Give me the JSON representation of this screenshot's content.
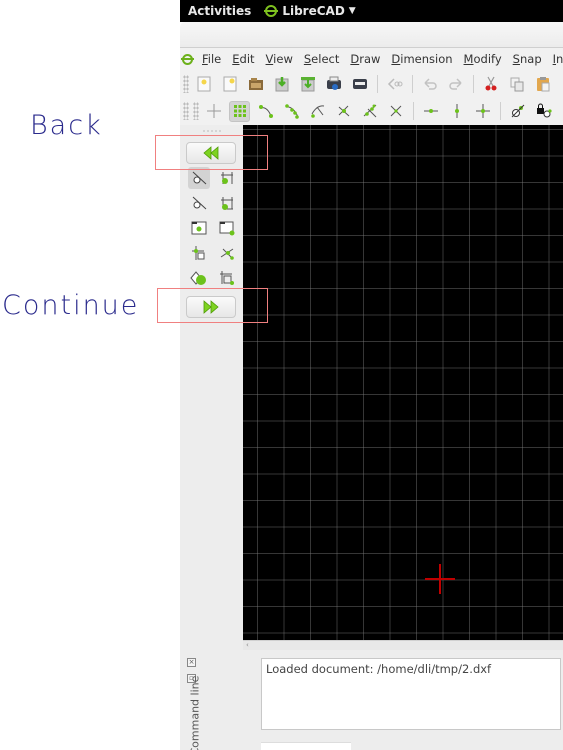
{
  "overlay": {
    "back_label": "Back",
    "continue_label": "Continue",
    "highlight_color": "#f08080",
    "label_color": "#2a2a8c"
  },
  "system_bar": {
    "activities": "Activities",
    "app_name": "LibreCAD",
    "app_menu_icon": "chevron-down-icon"
  },
  "menubar": {
    "items": [
      {
        "label": "File",
        "mnemonic": "F"
      },
      {
        "label": "Edit",
        "mnemonic": "E"
      },
      {
        "label": "View",
        "mnemonic": "V"
      },
      {
        "label": "Select",
        "mnemonic": "S"
      },
      {
        "label": "Draw",
        "mnemonic": "D"
      },
      {
        "label": "Dimension",
        "mnemonic": "D"
      },
      {
        "label": "Modify",
        "mnemonic": "M"
      },
      {
        "label": "Snap",
        "mnemonic": "S"
      },
      {
        "label": "Info",
        "mnemonic": "I"
      }
    ]
  },
  "toolbar_file": {
    "buttons": [
      "new-icon",
      "new-from-template-icon",
      "open-icon",
      "save-icon",
      "save-as-icon",
      "print-preview-icon",
      "print-icon",
      "zoom-previous-icon",
      "undo-icon",
      "redo-icon",
      "cut-icon",
      "copy-icon",
      "paste-icon"
    ]
  },
  "toolbar_snap": {
    "buttons": [
      "snap-free-icon",
      "snap-grid-icon",
      "snap-endpoints-icon",
      "snap-on-entity-icon",
      "snap-center-icon",
      "snap-middle-icon",
      "snap-distance-icon",
      "snap-intersection-icon",
      "restrict-horizontal-icon",
      "restrict-vertical-icon",
      "restrict-orthogonal-icon",
      "relative-zero-icon",
      "lock-relative-zero-icon"
    ],
    "active": "snap-grid-icon"
  },
  "tool_panel": {
    "back_button_icon": "double-chevron-left-icon",
    "continue_button_icon": "double-chevron-right-icon",
    "tools": [
      "select-entity",
      "select-window",
      "deselect-entity",
      "deselect-window",
      "select-all",
      "invert-selection",
      "select-intersected",
      "deselect-intersected",
      "select-layer",
      "select-contour"
    ]
  },
  "canvas": {
    "background": "#000000",
    "crosshair_color": "#c00000"
  },
  "command_line": {
    "title": "Command line",
    "output": "Loaded document: /home/dli/tmp/2.dxf"
  }
}
